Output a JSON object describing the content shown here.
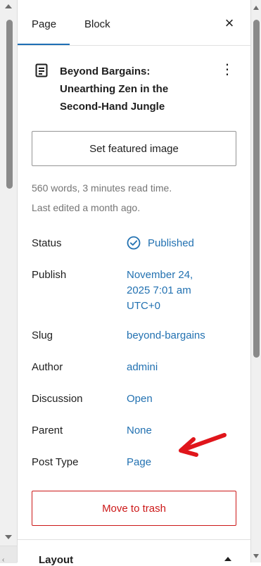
{
  "tabs": {
    "page": "Page",
    "block": "Block"
  },
  "close_glyph": "×",
  "post": {
    "title": "Beyond Bargains: Unearthing Zen in the Second-Hand Jungle",
    "menu_glyph": "⋮"
  },
  "featured_button": "Set featured image",
  "meta": {
    "words": "560 words, 3 minutes read time.",
    "edited": "Last edited a month ago."
  },
  "rows": {
    "status": {
      "label": "Status",
      "value": "Published"
    },
    "publish": {
      "label": "Publish",
      "value": "November 24, 2025 7:01 am UTC+0"
    },
    "slug": {
      "label": "Slug",
      "value": "beyond-bargains"
    },
    "author": {
      "label": "Author",
      "value": "admini"
    },
    "discussion": {
      "label": "Discussion",
      "value": "Open"
    },
    "parent": {
      "label": "Parent",
      "value": "None"
    },
    "post_type": {
      "label": "Post Type",
      "value": "Page"
    }
  },
  "trash_button": "Move to trash",
  "layout_section": {
    "title": "Layout"
  },
  "colors": {
    "accent": "#2271b1",
    "danger": "#cc1818",
    "annotation_arrow": "#e0151b"
  }
}
